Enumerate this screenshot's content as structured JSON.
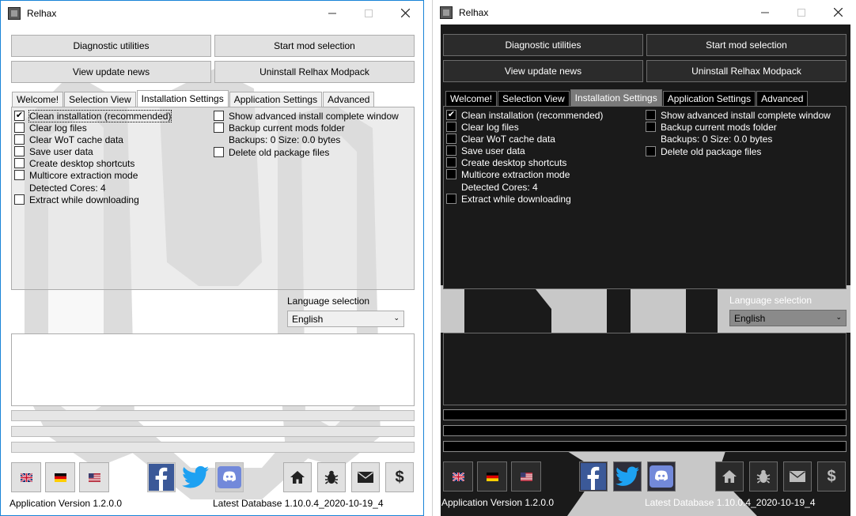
{
  "windows": [
    {
      "theme": "light"
    },
    {
      "theme": "dark"
    }
  ],
  "app": {
    "title": "Relhax",
    "app_icon": "relhax-icon",
    "controls": {
      "minimize": "minimize-icon",
      "maximize": "maximize-icon",
      "close": "close-icon"
    }
  },
  "buttons": {
    "diagnostic": "Diagnostic utilities",
    "start_mod": "Start mod selection",
    "update_news": "View update news",
    "uninstall": "Uninstall Relhax Modpack"
  },
  "tabs": [
    {
      "label": "Welcome!",
      "selected": false
    },
    {
      "label": "Selection View",
      "selected": false
    },
    {
      "label": "Installation Settings",
      "selected": true
    },
    {
      "label": "Application Settings",
      "selected": false
    },
    {
      "label": "Advanced",
      "selected": false
    }
  ],
  "settings": {
    "left": [
      {
        "label": "Clean installation (recommended)",
        "checked": true
      },
      {
        "label": "Clear log files",
        "checked": false
      },
      {
        "label": "Clear WoT cache data",
        "checked": false
      },
      {
        "label": "Save user data",
        "checked": false
      },
      {
        "label": "Create desktop shortcuts",
        "checked": false
      },
      {
        "label": "Multicore extraction mode",
        "checked": false
      }
    ],
    "detected_cores": "Detected Cores: 4",
    "extract_while_downloading": {
      "label": "Extract while downloading",
      "checked": false
    },
    "right": [
      {
        "label": "Show advanced install complete window",
        "checked": false
      },
      {
        "label": "Backup current mods folder",
        "checked": false
      }
    ],
    "backups_info": "Backups: 0  Size: 0.0 bytes",
    "delete_old": {
      "label": "Delete old package files",
      "checked": false
    }
  },
  "language": {
    "label": "Language selection",
    "selected": "English"
  },
  "progress_bars": [
    0,
    0,
    0
  ],
  "footer": {
    "flags": [
      {
        "name": "uk-flag-icon"
      },
      {
        "name": "germany-flag-icon"
      },
      {
        "name": "usa-flag-icon"
      }
    ],
    "social": [
      {
        "name": "facebook-icon"
      },
      {
        "name": "twitter-icon"
      },
      {
        "name": "discord-icon"
      }
    ],
    "tools": [
      {
        "name": "home-icon"
      },
      {
        "name": "bug-icon"
      },
      {
        "name": "mail-icon"
      },
      {
        "name": "donate-icon"
      }
    ],
    "app_version": "Application Version 1.2.0.0",
    "latest_db": "Latest Database 1.10.0.4_2020-10-19_4"
  },
  "colors": {
    "accent_border": "#1883d7",
    "facebook": "#3b5998",
    "twitter": "#1da1f2",
    "discord": "#7289da",
    "dark_bg": "#1a1a1a"
  }
}
